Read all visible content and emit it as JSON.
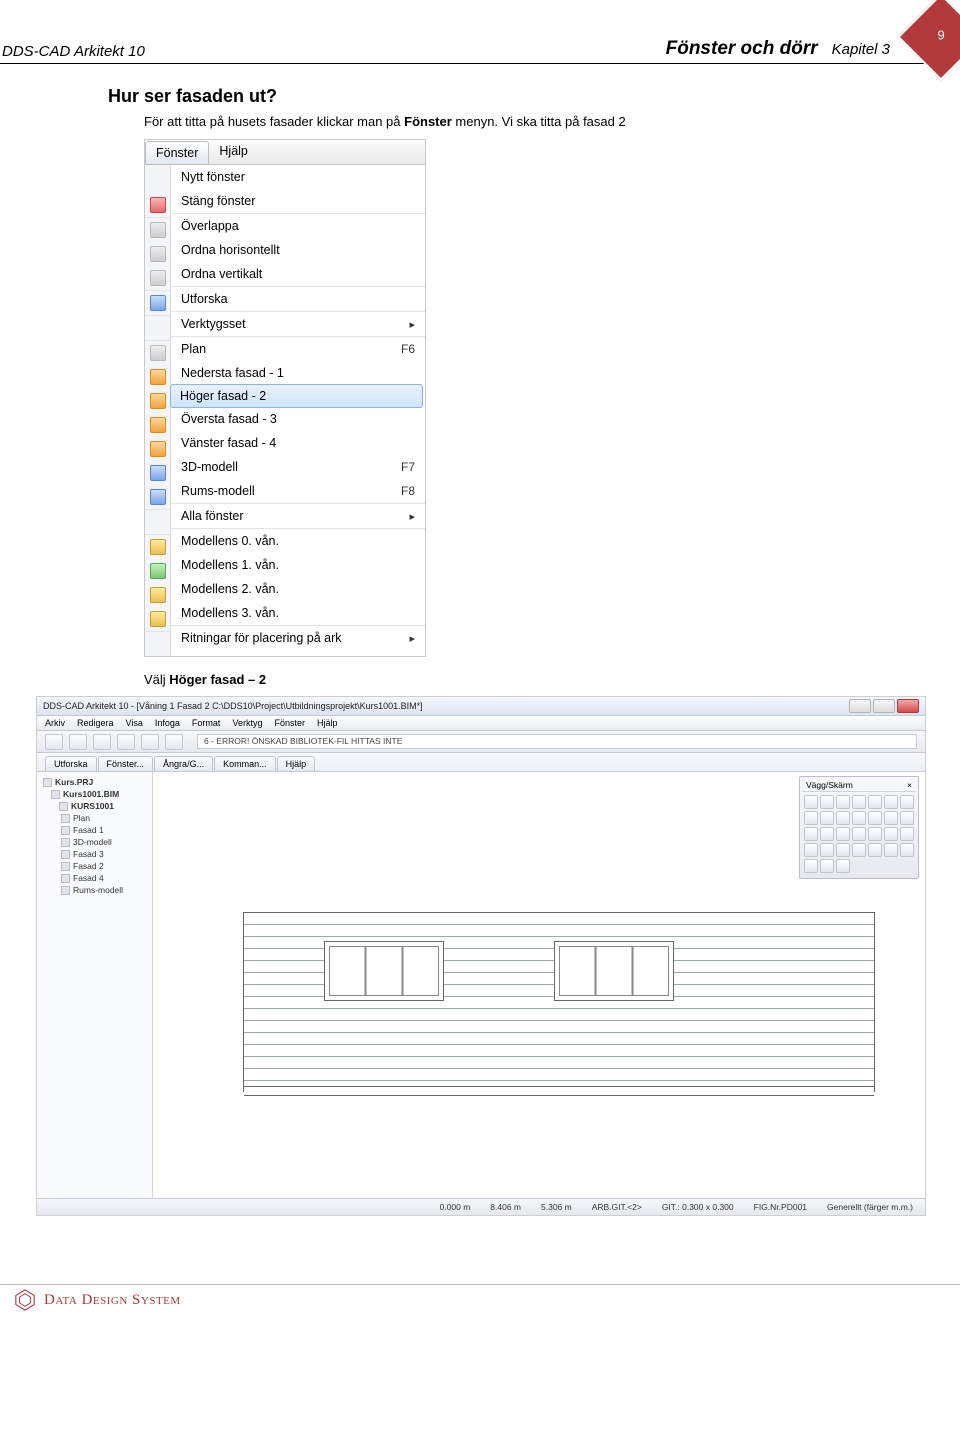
{
  "page": {
    "number": "9",
    "product": "DDS-CAD Arkitekt 10",
    "section_title": "Fönster och dörr",
    "chapter": "Kapitel 3"
  },
  "heading": "Hur ser fasaden ut?",
  "intro_pre": "För att titta på husets fasader klickar man på ",
  "intro_bold": "Fönster",
  "intro_post": " menyn. Vi ska titta på fasad 2",
  "menu": {
    "bar": {
      "fonster": "Fönster",
      "hjalp": "Hjälp"
    },
    "items": {
      "nytt": "Nytt fönster",
      "stang": "Stäng fönster",
      "overlappa": "Överlappa",
      "ordna_h": "Ordna horisontellt",
      "ordna_v": "Ordna vertikalt",
      "utforska": "Utforska",
      "verktyg": "Verktygsset",
      "plan": "Plan",
      "plan_key": "F6",
      "nedersta": "Nedersta fasad - 1",
      "hoger": "Höger fasad - 2",
      "oversta": "Översta fasad - 3",
      "vanster": "Vänster fasad - 4",
      "threed": "3D-modell",
      "threed_key": "F7",
      "rums": "Rums-modell",
      "rums_key": "F8",
      "alla": "Alla fönster",
      "m0": "Modellens 0. vån.",
      "m1": "Modellens 1. vån.",
      "m2": "Modellens 2. vån.",
      "m3": "Modellens 3. vån.",
      "ritningar": "Ritningar för placering på ark"
    }
  },
  "choose_pre": "Välj ",
  "choose_bold": "Höger fasad – 2",
  "app": {
    "title": "DDS-CAD Arkitekt 10 - [Våning 1  Fasad 2  C:\\DDS10\\Project\\Utbildningsprojekt\\Kurs1001.BIM*]",
    "menubar": [
      "Arkiv",
      "Redigera",
      "Visa",
      "Infoga",
      "Format",
      "Verktyg",
      "Fönster",
      "Hjälp"
    ],
    "toolbar_info": "6 - ERROR! ÖNSKAD BIBLIOTEK-FIL HITTAS INTE",
    "tabs": [
      "Utforska",
      "Fönster...",
      "Ångra/G...",
      "Komman...",
      "Hjälp"
    ],
    "tree": {
      "root": "Kurs.PRJ",
      "proj": "Kurs1001.BIM",
      "model": "KURS1001",
      "leaves": [
        "Plan",
        "Fasad 1",
        "3D-modell",
        "Fasad 3",
        "Fasad 2",
        "Fasad 4",
        "Rums-modell"
      ]
    },
    "palette_title": "Vägg/Skärm",
    "status": {
      "a": "0.000 m",
      "b": "8.406 m",
      "c": "5.306 m",
      "d": "ARB.GIT.<2>",
      "e": "GIT.: 0.300 x 0.300",
      "f": "FIG.Nr.PD001",
      "g": "Generellt (färger m.m.)"
    }
  },
  "footer": "Data Design System"
}
